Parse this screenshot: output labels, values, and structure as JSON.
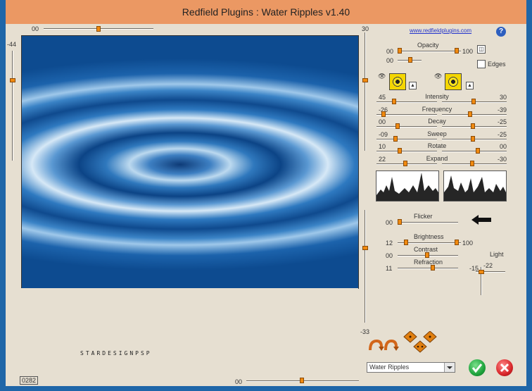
{
  "window": {
    "title": "Redfield Plugins : Water Ripples v1.40"
  },
  "header": {
    "link": "www.redfieldplugins.com",
    "help": "?"
  },
  "preview_sliders": {
    "top": "00",
    "right": "30",
    "left": "-44",
    "right_bottom": "-33",
    "bottom": "00"
  },
  "opacity": {
    "label": "Opacity",
    "min": "00",
    "max": "100",
    "second": "00"
  },
  "edges": {
    "label": "Edges"
  },
  "params": [
    {
      "label": "Intensity",
      "left": "45",
      "right": "30",
      "left_level": 0.27,
      "right_level": 0.49
    },
    {
      "label": "Frequency",
      "left": "-26",
      "right": "-39",
      "left_level": 0.09,
      "right_level": 0.43
    },
    {
      "label": "Decay",
      "left": "00",
      "right": "-25",
      "left_level": 0.34,
      "right_level": 0.48
    },
    {
      "label": "Sweep",
      "left": "-09",
      "right": "-25",
      "left_level": 0.3,
      "right_level": 0.48
    },
    {
      "label": "Rotate",
      "left": "10",
      "right": "00",
      "left_level": 0.38,
      "right_level": 0.56
    },
    {
      "label": "Expand",
      "left": "22",
      "right": "-30",
      "left_level": 0.48,
      "right_level": 0.46
    }
  ],
  "flicker": {
    "label": "Flicker",
    "value": "00"
  },
  "brightness": {
    "label": "Brightness",
    "left": "12",
    "right": "100"
  },
  "contrast": {
    "label": "Contrast",
    "value": "00"
  },
  "refraction": {
    "label": "Refraction",
    "value": "11"
  },
  "light": {
    "label": "Light",
    "x": "-15",
    "y": "-22"
  },
  "watermark": "STARDESIGNPSP",
  "counter": "0282",
  "preset": {
    "selected": "Water Ripples"
  },
  "colors": {
    "title_bg": "#eb9863",
    "frame": "#1f66a8",
    "panel": "#e6dfd1",
    "thumb": "#f08a10",
    "ok": "#1ea33c",
    "cancel": "#d8262a"
  }
}
